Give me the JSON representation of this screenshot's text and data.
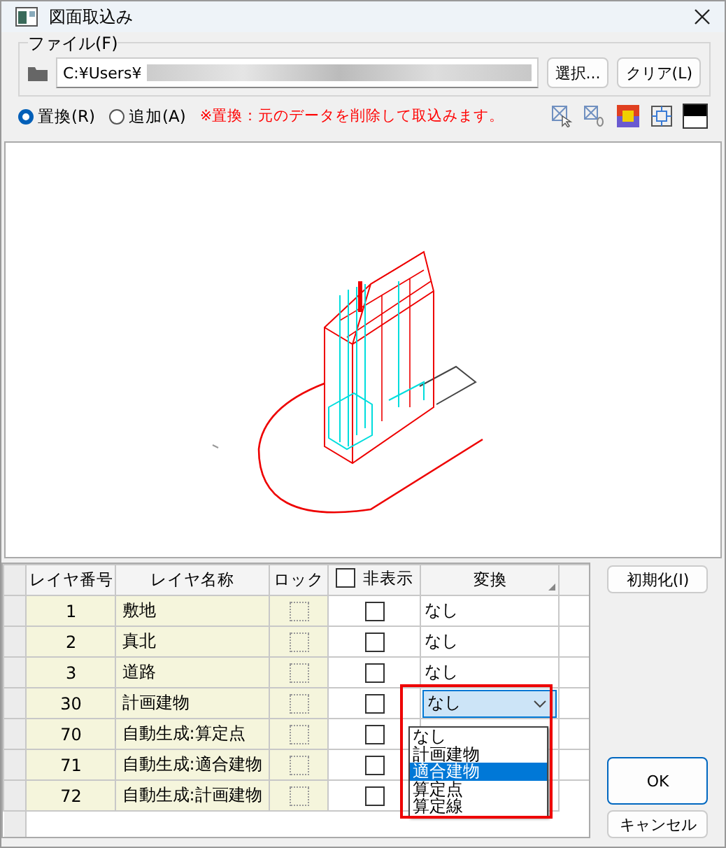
{
  "window": {
    "title": "図面取込み"
  },
  "file_group": {
    "label": "ファイル(F)",
    "path": "C:¥Users¥",
    "buttons": [
      "選択...",
      "クリア(L)"
    ]
  },
  "modes": [
    {
      "label": "置換(R)",
      "selected": true
    },
    {
      "label": "追加(A)",
      "selected": false
    }
  ],
  "warning": "※置換：元のデータを削除して取込みます。",
  "table": {
    "columns": [
      "レイヤ番号",
      "レイヤ名称",
      "ロック",
      "非表示",
      "変換"
    ],
    "hide_all_checked": false,
    "rows": [
      {
        "number": "1",
        "name": "敷地",
        "locked": false,
        "hidden": false,
        "kind": "text",
        "conversion": "なし"
      },
      {
        "number": "2",
        "name": "真北",
        "locked": false,
        "hidden": false,
        "kind": "text",
        "conversion": "なし"
      },
      {
        "number": "3",
        "name": "道路",
        "locked": false,
        "hidden": false,
        "kind": "text",
        "conversion": "なし"
      },
      {
        "number": "30",
        "name": "計画建物",
        "locked": false,
        "hidden": false,
        "kind": "combo",
        "conversion": "なし"
      },
      {
        "number": "70",
        "name": "自動生成:算定点",
        "locked": false,
        "hidden": false,
        "kind": "covered"
      },
      {
        "number": "71",
        "name": "自動生成:適合建物",
        "locked": false,
        "hidden": false,
        "kind": "covered"
      },
      {
        "number": "72",
        "name": "自動生成:計画建物",
        "locked": false,
        "hidden": false,
        "kind": "covered"
      }
    ],
    "dropdown_options": [
      {
        "label": "なし",
        "selected": false
      },
      {
        "label": "計画建物",
        "selected": false
      },
      {
        "label": "適合建物",
        "selected": true
      },
      {
        "label": "算定点",
        "selected": false
      },
      {
        "label": "算定線",
        "selected": false
      }
    ]
  },
  "side_buttons": [
    {
      "label": "初期化(I)",
      "kind": "top"
    },
    {
      "label": "OK",
      "kind": "default"
    },
    {
      "label": "キャンセル",
      "kind": "normal"
    }
  ]
}
